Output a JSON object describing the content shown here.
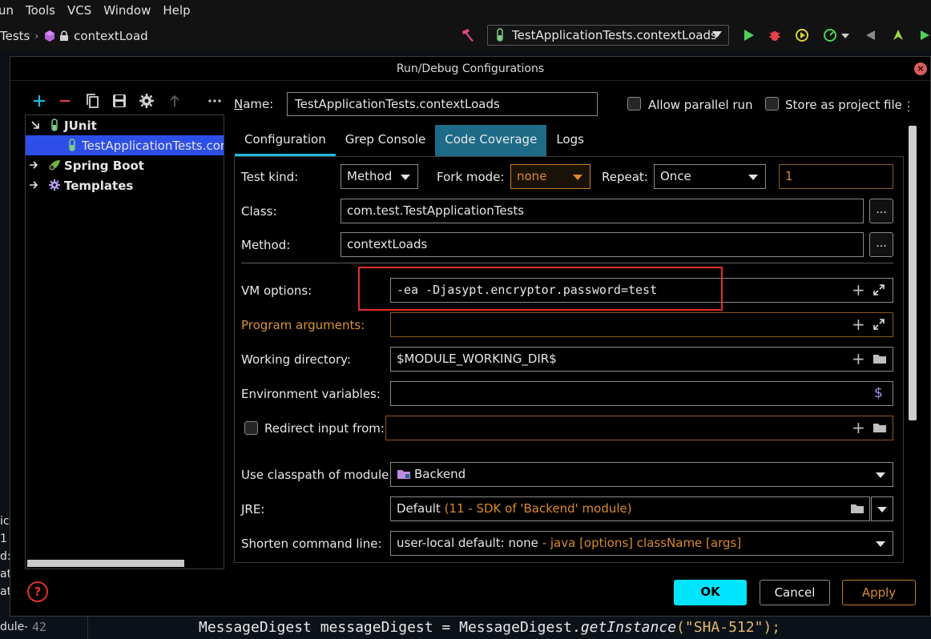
{
  "menubar": {
    "items": [
      "un",
      "Tools",
      "VCS",
      "Window",
      "Help"
    ]
  },
  "navbar": {
    "crumb1": "Tests",
    "crumb2": "contextLoad"
  },
  "run_config": {
    "label": "TestApplicationTests.contextLoads"
  },
  "dialog": {
    "title": "Run/Debug Configurations",
    "tree": {
      "junit": "JUnit",
      "selected": "TestApplicationTests.conte",
      "spring_boot": "Spring Boot",
      "templates": "Templates"
    },
    "name_label": "Name:",
    "name_value": "TestApplicationTests.contextLoads",
    "allow_parallel": "Allow parallel run",
    "store_project": "Store as project file",
    "tabs": [
      "Configuration",
      "Grep Console",
      "Code Coverage",
      "Logs"
    ],
    "form": {
      "test_kind_label": "Test kind:",
      "test_kind_value": "Method",
      "fork_mode_label": "Fork mode:",
      "fork_mode_value": "none",
      "repeat_label": "Repeat:",
      "repeat_value": "Once",
      "repeat_count": "1",
      "class_label": "Class:",
      "class_value": "com.test.TestApplicationTests",
      "method_label": "Method:",
      "method_value": "contextLoads",
      "vm_label": "VM options:",
      "vm_value": "-ea -Djasypt.encryptor.password=test",
      "program_args_label": "Program arguments:",
      "working_dir_label": "Working directory:",
      "working_dir_value": "$MODULE_WORKING_DIR$",
      "env_label": "Environment variables:",
      "redirect_label": "Redirect input from:",
      "classpath_label": "Use classpath of module:",
      "classpath_value": "Backend",
      "jre_label": "JRE:",
      "jre_value": "Default",
      "jre_hint": "(11 - SDK of 'Backend' module)",
      "shorten_label": "Shorten command line:",
      "shorten_value": "user-local default: none",
      "shorten_hint": "- java [options] className [args]",
      "dots": "..."
    },
    "buttons": {
      "ok": "OK",
      "cancel": "Cancel",
      "apply": "Apply",
      "help": "?"
    }
  },
  "left_edge": [
    "ic",
    "1",
    "d:",
    "at",
    "at"
  ],
  "code_line": {
    "module_prefix": "dule-p",
    "line_number": "42",
    "part1": "MessageDigest messageDigest = MessageDigest.",
    "method": "getInstance",
    "open": "(",
    "string": "\"SHA-512\"",
    "close": ");"
  },
  "colors": {
    "accent": "#00e5ff",
    "selection": "#2d4fe8",
    "warning": "#d98a2b",
    "highlight_box": "#e0302a"
  }
}
